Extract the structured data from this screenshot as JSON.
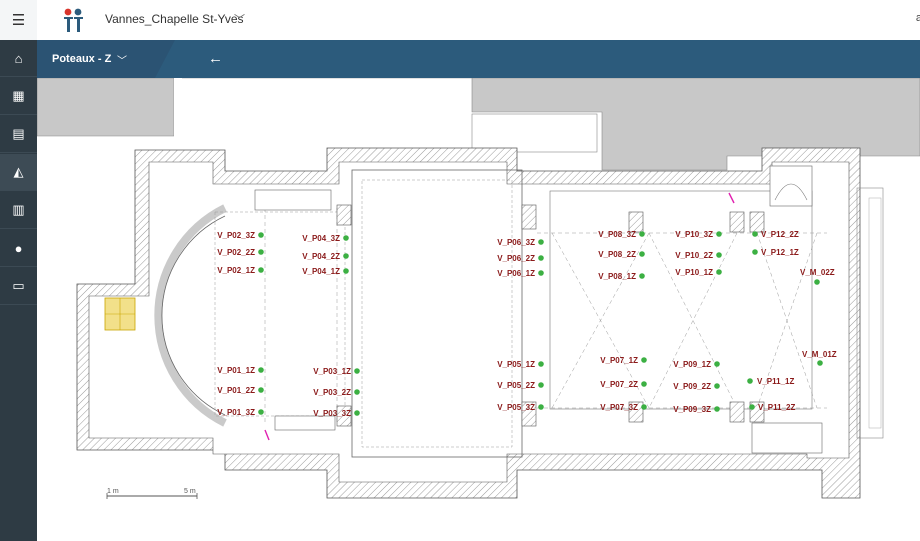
{
  "app": {
    "project_name": "Vannes_Chapelle St-Yves",
    "top_right_glyph": "a",
    "view_label": "Poteaux - Z"
  },
  "sidebar": {
    "items": [
      {
        "icon": "home-icon",
        "glyph": "⌂"
      },
      {
        "icon": "dashboard-icon",
        "glyph": "▦"
      },
      {
        "icon": "map-icon",
        "glyph": "▤"
      },
      {
        "icon": "chart-area-icon",
        "glyph": "◭"
      },
      {
        "icon": "building-icon",
        "glyph": "▥"
      },
      {
        "icon": "user-icon",
        "glyph": "●"
      },
      {
        "icon": "folder-open-icon",
        "glyph": "▭"
      }
    ]
  },
  "plan": {
    "scale_labels": [
      "1 m",
      "5 m"
    ],
    "sensors": [
      {
        "label": "V_P02_3Z",
        "anchor": "end"
      },
      {
        "label": "V_P02_2Z",
        "anchor": "end"
      },
      {
        "label": "V_P02_1Z",
        "anchor": "end"
      },
      {
        "label": "V_P01_1Z",
        "anchor": "end"
      },
      {
        "label": "V_P01_2Z",
        "anchor": "end"
      },
      {
        "label": "V_P01_3Z",
        "anchor": "end"
      },
      {
        "label": "V_P04_3Z",
        "anchor": "end"
      },
      {
        "label": "V_P04_2Z",
        "anchor": "end"
      },
      {
        "label": "V_P04_1Z",
        "anchor": "end"
      },
      {
        "label": "V_P03_1Z",
        "anchor": "end"
      },
      {
        "label": "V_P03_2Z",
        "anchor": "end"
      },
      {
        "label": "V_P03_3Z",
        "anchor": "end"
      },
      {
        "label": "V_P06_3Z",
        "anchor": "end"
      },
      {
        "label": "V_P06_2Z",
        "anchor": "end"
      },
      {
        "label": "V_P06_1Z",
        "anchor": "end"
      },
      {
        "label": "V_P05_1Z",
        "anchor": "end"
      },
      {
        "label": "V_P05_2Z",
        "anchor": "end"
      },
      {
        "label": "V_P05_3Z",
        "anchor": "end"
      },
      {
        "label": "V_P08_3Z",
        "anchor": "end"
      },
      {
        "label": "V_P08_2Z",
        "anchor": "end"
      },
      {
        "label": "V_P08_1Z",
        "anchor": "end"
      },
      {
        "label": "V_P07_1Z",
        "anchor": "end"
      },
      {
        "label": "V_P07_2Z",
        "anchor": "end"
      },
      {
        "label": "V_P07_3Z",
        "anchor": "end"
      },
      {
        "label": "V_P10_3Z",
        "anchor": "end"
      },
      {
        "label": "V_P10_2Z",
        "anchor": "end"
      },
      {
        "label": "V_P10_1Z",
        "anchor": "end"
      },
      {
        "label": "V_P09_1Z",
        "anchor": "end"
      },
      {
        "label": "V_P09_2Z",
        "anchor": "end"
      },
      {
        "label": "V_P09_3Z",
        "anchor": "end"
      },
      {
        "label": "V_P12_2Z",
        "anchor": "start"
      },
      {
        "label": "V_P12_1Z",
        "anchor": "start"
      },
      {
        "label": "V_M_02Z",
        "anchor": "start"
      },
      {
        "label": "V_M_01Z",
        "anchor": "start"
      },
      {
        "label": "V_P11_1Z",
        "anchor": "start"
      },
      {
        "label": "V_P11_2Z",
        "anchor": "start"
      }
    ],
    "colors": {
      "sensor_dot": "#3cb043",
      "sensor_label": "#8b1a1a",
      "header": "#2c5b7c"
    }
  }
}
